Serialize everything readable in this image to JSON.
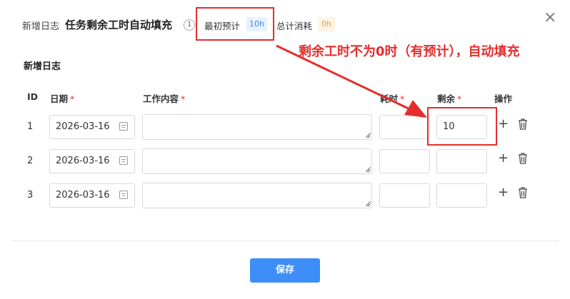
{
  "header": {
    "prefix": "新增日志",
    "title": "任务剩余工时自动填充",
    "task_num": "1",
    "estimate_label": "最初预计",
    "estimate_value": "10h",
    "consumed_label": "总计消耗",
    "consumed_value": "0h",
    "close_icon": "×"
  },
  "annotation": "剩余工时不为0时（有预计），自动填充",
  "form": {
    "section_title": "新增日志",
    "columns": {
      "id": "ID",
      "date": "日期",
      "content": "工作内容",
      "hours": "耗时",
      "remaining": "剩余",
      "actions": "操作"
    },
    "required_mark": "*",
    "rows": [
      {
        "id": "1",
        "date": "2026-03-16",
        "content": "",
        "hours": "",
        "remaining": "10"
      },
      {
        "id": "2",
        "date": "2026-03-16",
        "content": "",
        "hours": "",
        "remaining": ""
      },
      {
        "id": "3",
        "date": "2026-03-16",
        "content": "",
        "hours": "",
        "remaining": ""
      }
    ],
    "add_icon": "+"
  },
  "footer": {
    "save_label": "保存"
  },
  "colors": {
    "accent": "#3e8ef7",
    "annotation": "#e62d2d",
    "estimate_badge": "#e6f2fd",
    "consumed_badge": "#fff3e6"
  }
}
